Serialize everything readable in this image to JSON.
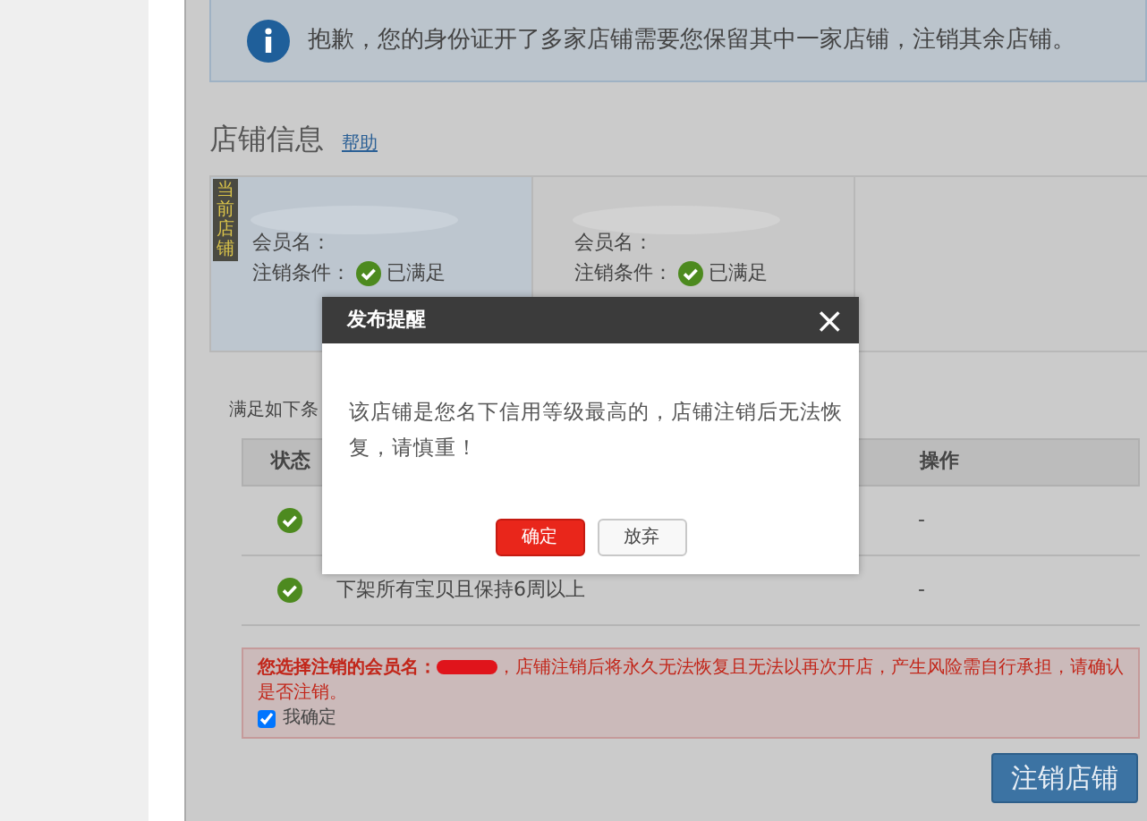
{
  "notice": {
    "text": "抱歉，您的身份证开了多家店铺需要您保留其中一家店铺，注销其余店铺。"
  },
  "section": {
    "title": "店铺信息",
    "help_link": "帮助"
  },
  "shops": [
    {
      "current": true,
      "tag": "当前店铺",
      "member_label": "会员名：",
      "condition_label": "注销条件：",
      "condition_status": "已满足"
    },
    {
      "current": false,
      "member_label": "会员名：",
      "condition_label": "注销条件：",
      "condition_status": "已满足"
    }
  ],
  "conditions_intro": "满足如下条",
  "table": {
    "columns": [
      "状态",
      "操作"
    ],
    "rows": [
      {
        "met": true,
        "action": "-"
      },
      {
        "met": true,
        "condition": "下架所有宝贝且保持6周以上",
        "action": "-"
      }
    ]
  },
  "warning": {
    "text_before": "您选择注销的会员名：",
    "text_after": "，店铺注销后将永久无法恢复且无法以再次开店，产生风险需自行承担，请确认是否注销。",
    "confirm": {
      "label": "我确定",
      "checked": true
    }
  },
  "submit_button": "注销店铺",
  "dialog": {
    "title": "发布提醒",
    "close": "×",
    "message": "该店铺是您名下信用等级最高的，店铺注销后无法恢复，请慎重！",
    "buttons": [
      {
        "label": "确定",
        "kind": "primary"
      },
      {
        "label": "放弃",
        "kind": "secondary"
      }
    ]
  }
}
